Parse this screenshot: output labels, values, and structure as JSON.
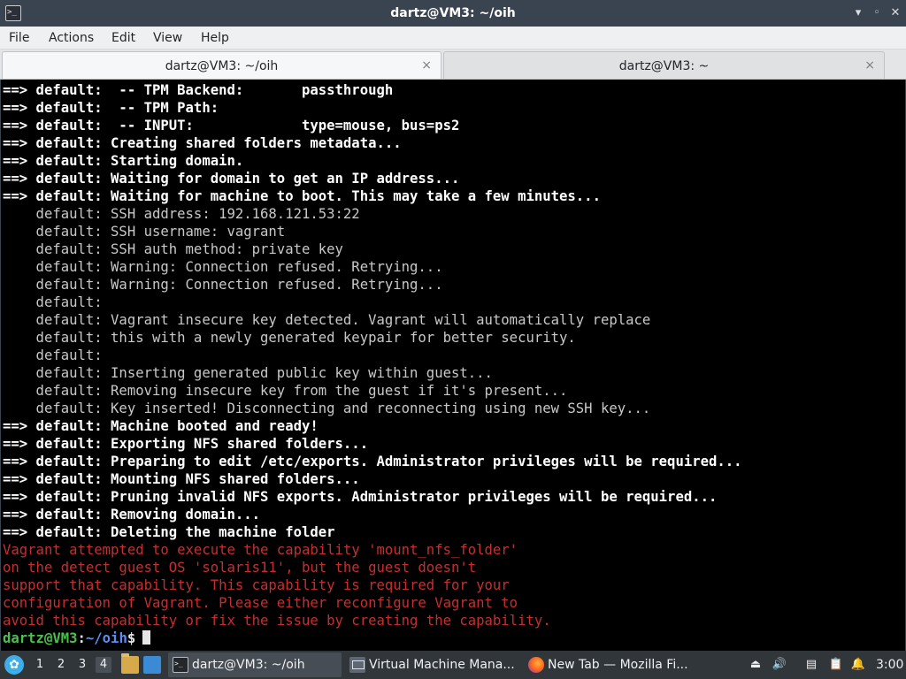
{
  "window": {
    "title": "dartz@VM3: ~/oih",
    "icon": "terminal-icon"
  },
  "menubar": {
    "items": [
      "File",
      "Actions",
      "Edit",
      "View",
      "Help"
    ]
  },
  "tabs": [
    {
      "label": "dartz@VM3: ~/oih",
      "close": "×",
      "active": true
    },
    {
      "label": "dartz@VM3: ~",
      "close": "×",
      "active": false
    }
  ],
  "terminal": {
    "lines": [
      {
        "style": "bold",
        "text": "==> default:  -- TPM Backend:       passthrough"
      },
      {
        "style": "bold",
        "text": "==> default:  -- TPM Path:"
      },
      {
        "style": "bold",
        "text": "==> default:  -- INPUT:             type=mouse, bus=ps2"
      },
      {
        "style": "bold",
        "text": "==> default: Creating shared folders metadata..."
      },
      {
        "style": "bold",
        "text": "==> default: Starting domain."
      },
      {
        "style": "bold",
        "text": "==> default: Waiting for domain to get an IP address..."
      },
      {
        "style": "bold",
        "text": "==> default: Waiting for machine to boot. This may take a few minutes..."
      },
      {
        "style": "dim",
        "text": "    default: SSH address: 192.168.121.53:22"
      },
      {
        "style": "dim",
        "text": "    default: SSH username: vagrant"
      },
      {
        "style": "dim",
        "text": "    default: SSH auth method: private key"
      },
      {
        "style": "dim",
        "text": "    default: Warning: Connection refused. Retrying..."
      },
      {
        "style": "dim",
        "text": "    default: Warning: Connection refused. Retrying..."
      },
      {
        "style": "dim",
        "text": "    default:"
      },
      {
        "style": "dim",
        "text": "    default: Vagrant insecure key detected. Vagrant will automatically replace"
      },
      {
        "style": "dim",
        "text": "    default: this with a newly generated keypair for better security."
      },
      {
        "style": "dim",
        "text": "    default:"
      },
      {
        "style": "dim",
        "text": "    default: Inserting generated public key within guest..."
      },
      {
        "style": "dim",
        "text": "    default: Removing insecure key from the guest if it's present..."
      },
      {
        "style": "dim",
        "text": "    default: Key inserted! Disconnecting and reconnecting using new SSH key..."
      },
      {
        "style": "bold",
        "text": "==> default: Machine booted and ready!"
      },
      {
        "style": "bold",
        "text": "==> default: Exporting NFS shared folders..."
      },
      {
        "style": "bold",
        "text": "==> default: Preparing to edit /etc/exports. Administrator privileges will be required..."
      },
      {
        "style": "bold",
        "text": "==> default: Mounting NFS shared folders..."
      },
      {
        "style": "bold",
        "text": "==> default: Pruning invalid NFS exports. Administrator privileges will be required..."
      },
      {
        "style": "bold",
        "text": "==> default: Removing domain..."
      },
      {
        "style": "bold",
        "text": "==> default: Deleting the machine folder"
      },
      {
        "style": "err",
        "text": "Vagrant attempted to execute the capability 'mount_nfs_folder'"
      },
      {
        "style": "err",
        "text": "on the detect guest OS 'solaris11', but the guest doesn't"
      },
      {
        "style": "err",
        "text": "support that capability. This capability is required for your"
      },
      {
        "style": "err",
        "text": "configuration of Vagrant. Please either reconfigure Vagrant to"
      },
      {
        "style": "err",
        "text": "avoid this capability or fix the issue by creating the capability."
      }
    ],
    "prompt": {
      "user": "dartz@VM3",
      "colon": ":",
      "path": "~/oih",
      "symbol": "$"
    }
  },
  "taskbar": {
    "launcher_icon": "application-launcher-icon",
    "desktops": [
      "1",
      "2",
      "3",
      "4"
    ],
    "current_desktop": "4",
    "quick_icons": [
      "file-manager-icon",
      "show-desktop-icon"
    ],
    "tasks": [
      {
        "label": "dartz@VM3: ~/oih",
        "icon": "terminal-icon",
        "active": true
      },
      {
        "label": "Virtual Machine Mana...",
        "icon": "virt-manager-icon",
        "active": false
      },
      {
        "label": "New Tab — Mozilla Fi...",
        "icon": "firefox-icon",
        "active": false
      }
    ],
    "tray_icons": [
      "removable-media-icon",
      "volume-icon",
      "network-icon",
      "clipboard-icon",
      "notifications-icon"
    ],
    "clock": "3:00"
  }
}
